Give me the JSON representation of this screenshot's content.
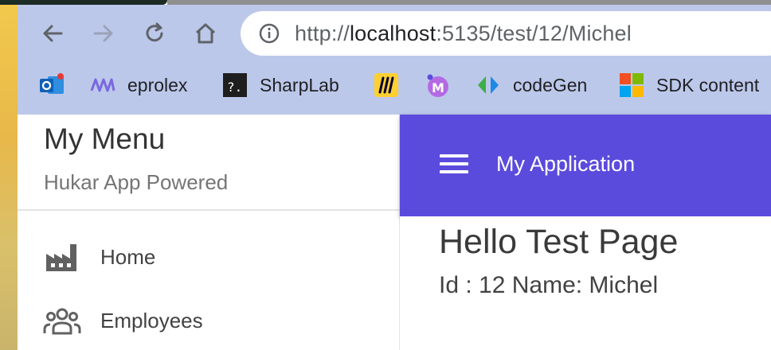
{
  "browser": {
    "url_scheme": "http://",
    "url_host": "localhost",
    "url_rest": ":5135/test/12/Michel",
    "bookmarks": [
      {
        "label": "",
        "icon": "outlook-icon"
      },
      {
        "label": "eprolex",
        "icon": "eprolex-icon"
      },
      {
        "label": "SharpLab",
        "icon": "terminal-icon"
      },
      {
        "label": "",
        "icon": "miro-icon"
      },
      {
        "label": "",
        "icon": "m-app-icon"
      },
      {
        "label": "codeGen",
        "icon": "codegen-icon"
      },
      {
        "label": "SDK content",
        "icon": "microsoft-icon"
      }
    ]
  },
  "drawer": {
    "title": "My Menu",
    "subtitle": "Hukar App Powered",
    "items": [
      {
        "label": "Home",
        "icon": "factory-icon"
      },
      {
        "label": "Employees",
        "icon": "people-icon"
      }
    ]
  },
  "appbar": {
    "title": "My Application"
  },
  "page": {
    "title": "Hello Test Page",
    "subtitle": "Id : 12 Name: Michel"
  },
  "colors": {
    "chrome_bg": "#bcc8ea",
    "appbar_bg": "#5b4bdc",
    "text_primary": "#333333"
  }
}
